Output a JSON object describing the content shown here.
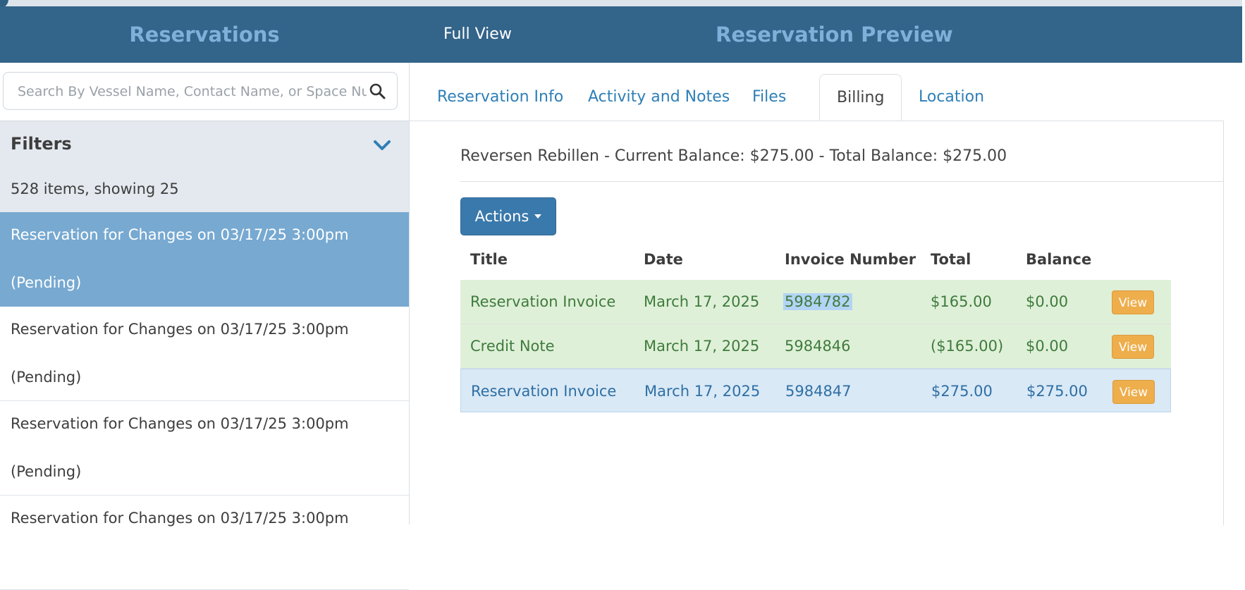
{
  "header": {
    "left_title": "Reservations",
    "full_view_label": "Full View",
    "right_title": "Reservation Preview"
  },
  "search": {
    "placeholder": "Search By Vessel Name, Contact Name, or Space Number",
    "icon": "search-icon"
  },
  "filters": {
    "title": "Filters",
    "count_text": "528 items, showing 25",
    "toggle_icon": "chevron-down-icon"
  },
  "reservations": [
    {
      "line1": "Reservation for Changes on 03/17/25 3:00pm",
      "line2": "(Pending)",
      "active": true
    },
    {
      "line1": "Reservation for Changes on 03/17/25 3:00pm",
      "line2": "(Pending)",
      "active": false
    },
    {
      "line1": "Reservation for Changes on 03/17/25 3:00pm",
      "line2": "(Pending)",
      "active": false
    },
    {
      "line1": "Reservation for Changes on 03/17/25 3:00pm",
      "line2": "",
      "active": false
    }
  ],
  "tabs": [
    {
      "label": "Reservation Info",
      "active": false
    },
    {
      "label": "Activity and Notes",
      "active": false
    },
    {
      "label": "Files",
      "active": false
    },
    {
      "label": "Billing",
      "active": true
    },
    {
      "label": "Location",
      "active": false
    }
  ],
  "billing": {
    "summary": "Reversen Rebillen - Current Balance: $275.00 - Total Balance: $275.00",
    "actions_label": "Actions",
    "columns": [
      "Title",
      "Date",
      "Invoice Number",
      "Total",
      "Balance"
    ],
    "rows": [
      {
        "title": "Reservation Invoice",
        "date": "March 17, 2025",
        "invoice": "5984782",
        "total": "$165.00",
        "balance": "$0.00",
        "view": "View",
        "style": "green",
        "invoice_selected": true
      },
      {
        "title": "Credit Note",
        "date": "March 17, 2025",
        "invoice": "5984846",
        "total": "($165.00)",
        "balance": "$0.00",
        "view": "View",
        "style": "green",
        "invoice_selected": false
      },
      {
        "title": "Reservation Invoice",
        "date": "March 17, 2025",
        "invoice": "5984847",
        "total": "$275.00",
        "balance": "$275.00",
        "view": "View",
        "style": "blue",
        "invoice_selected": false
      }
    ]
  },
  "colors": {
    "header_bg": "#33648a",
    "header_title": "#7fb0da",
    "active_item": "#77a9d1",
    "link": "#2f7fb6",
    "paid_row": "#dff0d8",
    "open_row": "#d9e9f6",
    "view_button": "#eeae4c"
  }
}
